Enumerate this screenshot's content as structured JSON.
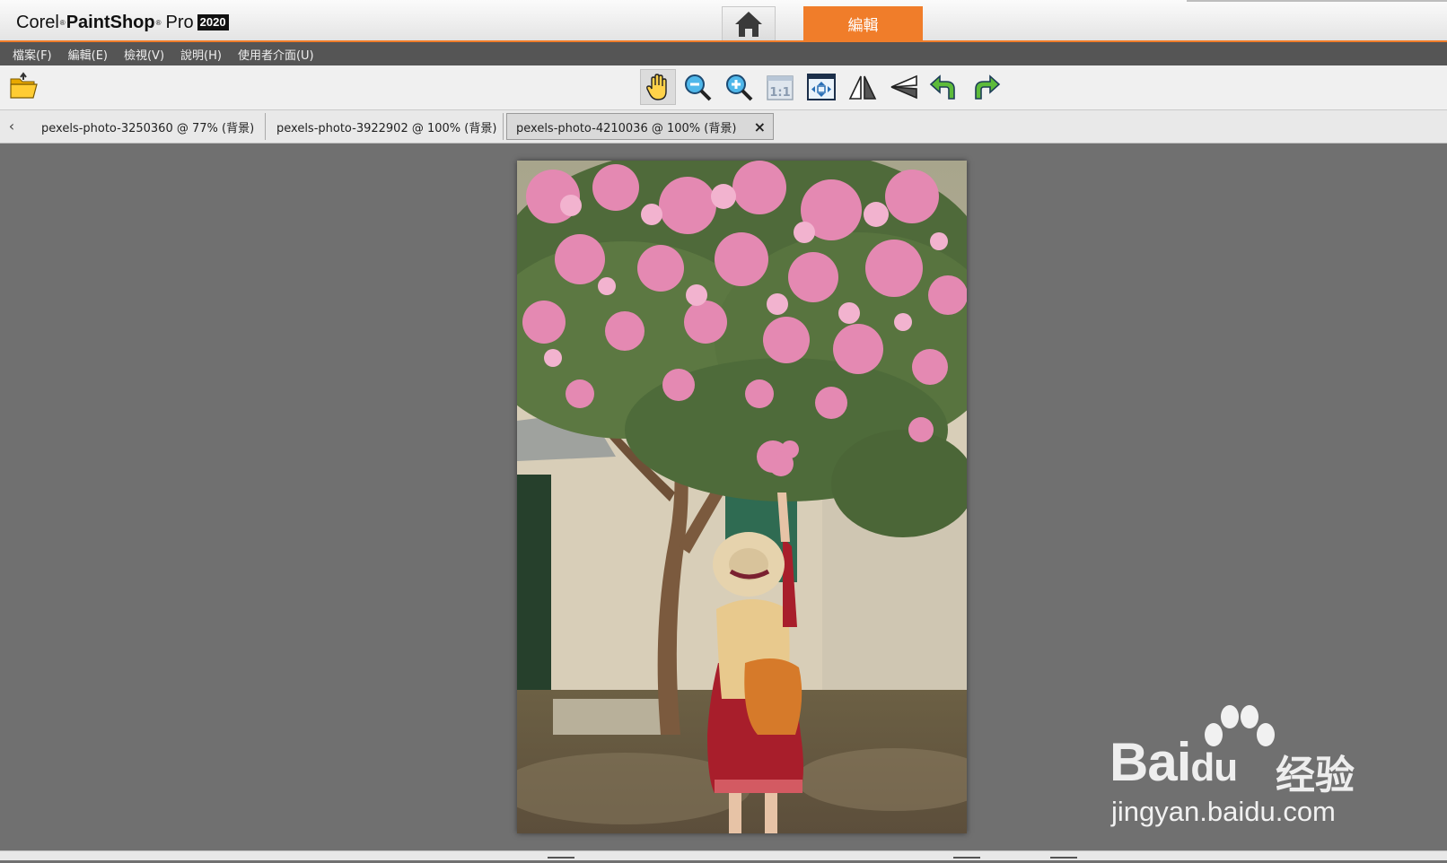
{
  "app": {
    "logo_corel": "Corel",
    "logo_paintshop": "PaintShop",
    "logo_pro": "Pro",
    "logo_year": "2020",
    "edit_tab_label": "編輯",
    "accent_color": "#f07d2a"
  },
  "menu": [
    "檔案(F)",
    "編輯(E)",
    "檢視(V)",
    "說明(H)",
    "使用者介面(U)"
  ],
  "toolbar": {
    "open_icon": "folder-open-icon",
    "tools": [
      "pan-hand-icon",
      "zoom-out-icon",
      "zoom-in-icon",
      "actual-size-icon",
      "fit-window-icon",
      "flip-horizontal-icon",
      "flip-vertical-icon",
      "rotate-left-icon",
      "rotate-right-icon"
    ],
    "actual_size_label": "1:1",
    "active_tool": "pan-hand-icon"
  },
  "tabs": [
    {
      "label": "pexels-photo-3250360 @  77% (背景)",
      "active": false
    },
    {
      "label": "pexels-photo-3922902 @ 100% (背景)",
      "active": false
    },
    {
      "label": "pexels-photo-4210036 @ 100% (背景)",
      "active": true
    }
  ],
  "tab_close": "×",
  "tab_scroll": "‹",
  "watermark": {
    "brand": "Bai",
    "brand_suffix": "du",
    "cn": "经验",
    "url": "jingyan.baidu.com"
  }
}
